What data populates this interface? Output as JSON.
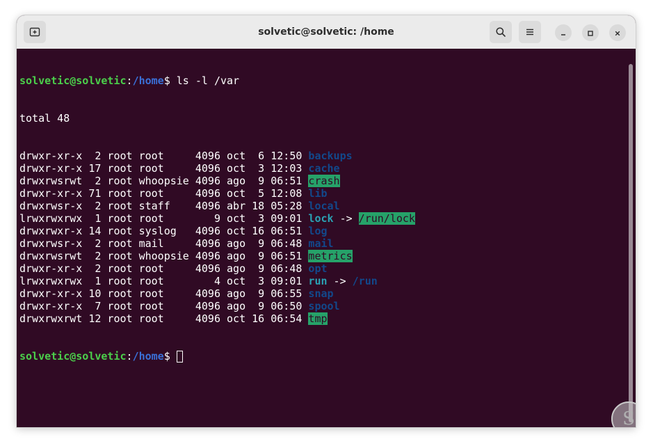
{
  "window": {
    "title": "solvetic@solvetic: /home"
  },
  "icons": {
    "new_tab": "new-tab-icon",
    "search": "search-icon",
    "menu": "hamburger-menu-icon",
    "minimize": "minimize-icon",
    "maximize": "maximize-icon",
    "close": "close-icon",
    "watermark": "solvetic-logo"
  },
  "colors": {
    "terminal_bg": "#300a24",
    "prompt_user": "#4bcf4b",
    "prompt_path": "#3a70d8",
    "directory": "#12488b",
    "sticky_bg": "#26a269",
    "symlink": "#2aa1b3"
  },
  "terminal": {
    "prompt_user": "solvetic@solvetic",
    "prompt_sep": ":",
    "prompt_path": "/home",
    "prompt_dollar": "$ ",
    "command": "ls -l /var",
    "total": "total 48",
    "rows": [
      {
        "meta": "drwxr-xr-x  2 root root     4096 oct  6 12:50 ",
        "name": "backups",
        "kind": "dir"
      },
      {
        "meta": "drwxr-xr-x 17 root root     4096 oct  3 12:03 ",
        "name": "cache",
        "kind": "dir"
      },
      {
        "meta": "drwxrwsrwt  2 root whoopsie 4096 ago  9 06:51 ",
        "name": "crash",
        "kind": "sticky"
      },
      {
        "meta": "drwxr-xr-x 71 root root     4096 oct  5 12:08 ",
        "name": "lib",
        "kind": "dir"
      },
      {
        "meta": "drwxrwsr-x  2 root staff    4096 abr 18 05:28 ",
        "name": "local",
        "kind": "dir"
      },
      {
        "meta": "lrwxrwxrwx  1 root root        9 oct  3 09:01 ",
        "name": "lock",
        "kind": "link",
        "arrow": " -> ",
        "target": "/run/lock",
        "target_kind": "sticky"
      },
      {
        "meta": "drwxrwxr-x 14 root syslog   4096 oct 16 06:51 ",
        "name": "log",
        "kind": "dir"
      },
      {
        "meta": "drwxrwsr-x  2 root mail     4096 ago  9 06:48 ",
        "name": "mail",
        "kind": "dir"
      },
      {
        "meta": "drwxrwsrwt  2 root whoopsie 4096 ago  9 06:51 ",
        "name": "metrics",
        "kind": "sticky"
      },
      {
        "meta": "drwxr-xr-x  2 root root     4096 ago  9 06:48 ",
        "name": "opt",
        "kind": "dir"
      },
      {
        "meta": "lrwxrwxrwx  1 root root        4 oct  3 09:01 ",
        "name": "run",
        "kind": "link",
        "arrow": " -> ",
        "target": "/run",
        "target_kind": "dir"
      },
      {
        "meta": "drwxr-xr-x 10 root root     4096 ago  9 06:55 ",
        "name": "snap",
        "kind": "dir"
      },
      {
        "meta": "drwxr-xr-x  7 root root     4096 ago  9 06:50 ",
        "name": "spool",
        "kind": "dir"
      },
      {
        "meta": "drwxrwxrwt 12 root root     4096 oct 16 06:54 ",
        "name": "tmp",
        "kind": "sticky"
      }
    ]
  }
}
